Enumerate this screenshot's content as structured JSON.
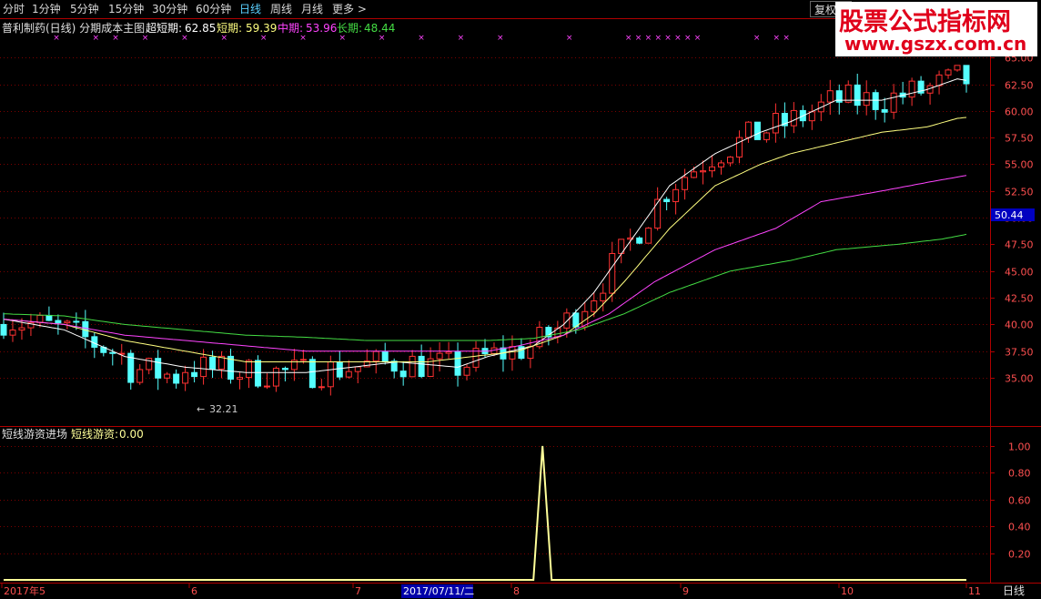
{
  "toolbar": {
    "items": [
      "分时",
      "1分钟",
      "5分钟",
      "15分钟",
      "30分钟",
      "60分钟",
      "日线",
      "周线",
      "月线",
      "更多 >"
    ],
    "active": "日线",
    "fuquan": "复权"
  },
  "watermark": {
    "line1": "股票公式指标网",
    "line2": "www.gszx.com.cn"
  },
  "main_legend": {
    "title": "普利制药(日线) 分期成本主图",
    "items": [
      {
        "label": "超短期:",
        "value": "62.85",
        "color": "#ffffff"
      },
      {
        "label": "短期:",
        "value": "59.39",
        "color": "#ffff80"
      },
      {
        "label": "中期:",
        "value": "53.96",
        "color": "#ff44ff"
      },
      {
        "label": "长期:",
        "value": "48.44",
        "color": "#44dd44"
      }
    ]
  },
  "sub_legend": {
    "title": "短线游资进场",
    "label": "短线游资:",
    "value": "0.00"
  },
  "price_axis": {
    "ticks": [
      "65.00",
      "62.50",
      "60.00",
      "57.50",
      "55.00",
      "52.50",
      "50.00",
      "47.50",
      "45.00",
      "42.50",
      "40.00",
      "37.50",
      "35.00"
    ],
    "current_price": "50.44"
  },
  "sub_axis": {
    "ticks": [
      "1.00",
      "0.80",
      "0.60",
      "0.40",
      "0.20"
    ]
  },
  "date_axis": {
    "labels": [
      "2017年5",
      "6",
      "7",
      "8",
      "9",
      "10",
      "11"
    ],
    "cursor_date": "2017/07/11/二",
    "period": "日线"
  },
  "annotations": {
    "low_label": "32.21"
  },
  "colors": {
    "up": "#ff3232",
    "down": "#54ffff",
    "axis": "#b00000",
    "grid": "#7a0000",
    "signal": "#ffff99",
    "marker": "#ff44ff"
  },
  "chart_data": [
    {
      "type": "candlestick",
      "title": "普利制药(日线)",
      "ylim": [
        31,
        68
      ],
      "series": [
        {
          "name": "超短期",
          "points": [
            [
              0,
              40.5
            ],
            [
              20,
              39.5
            ],
            [
              40,
              37
            ],
            [
              60,
              36
            ],
            [
              80,
              35.5
            ],
            [
              100,
              35.5
            ],
            [
              115,
              36
            ],
            [
              130,
              36.5
            ],
            [
              150,
              36
            ],
            [
              160,
              37
            ],
            [
              175,
              38
            ],
            [
              185,
              40
            ],
            [
              195,
              43
            ],
            [
              205,
              47
            ],
            [
              220,
              53
            ],
            [
              235,
              56
            ],
            [
              250,
              58
            ],
            [
              260,
              59
            ],
            [
              275,
              61
            ],
            [
              290,
              61
            ],
            [
              305,
              62
            ],
            [
              315,
              63
            ],
            [
              318,
              62.85
            ]
          ]
        },
        {
          "name": "短期",
          "points": [
            [
              0,
              40.5
            ],
            [
              20,
              40
            ],
            [
              40,
              38.5
            ],
            [
              60,
              37.5
            ],
            [
              80,
              36.5
            ],
            [
              100,
              36.5
            ],
            [
              120,
              36.5
            ],
            [
              140,
              36.5
            ],
            [
              155,
              37
            ],
            [
              170,
              37.5
            ],
            [
              185,
              39
            ],
            [
              195,
              41
            ],
            [
              205,
              44
            ],
            [
              220,
              49
            ],
            [
              235,
              53
            ],
            [
              250,
              55
            ],
            [
              260,
              56
            ],
            [
              275,
              57
            ],
            [
              290,
              58
            ],
            [
              305,
              58.5
            ],
            [
              315,
              59.3
            ],
            [
              318,
              59.39
            ]
          ]
        },
        {
          "name": "中期",
          "points": [
            [
              0,
              40.5
            ],
            [
              20,
              40
            ],
            [
              40,
              39
            ],
            [
              60,
              38.5
            ],
            [
              80,
              38
            ],
            [
              100,
              37.5
            ],
            [
              120,
              37.5
            ],
            [
              140,
              37.5
            ],
            [
              160,
              37.5
            ],
            [
              170,
              38
            ],
            [
              185,
              39
            ],
            [
              200,
              41
            ],
            [
              215,
              44
            ],
            [
              235,
              47
            ],
            [
              255,
              49
            ],
            [
              270,
              51.5
            ],
            [
              290,
              52.5
            ],
            [
              305,
              53.3
            ],
            [
              318,
              53.96
            ]
          ]
        },
        {
          "name": "长期",
          "points": [
            [
              0,
              41
            ],
            [
              20,
              40.8
            ],
            [
              40,
              40
            ],
            [
              60,
              39.5
            ],
            [
              80,
              39
            ],
            [
              100,
              38.8
            ],
            [
              120,
              38.5
            ],
            [
              140,
              38.5
            ],
            [
              160,
              38.5
            ],
            [
              175,
              38.7
            ],
            [
              190,
              39.5
            ],
            [
              205,
              41
            ],
            [
              220,
              43
            ],
            [
              240,
              45
            ],
            [
              260,
              46
            ],
            [
              275,
              47
            ],
            [
              295,
              47.5
            ],
            [
              310,
              48
            ],
            [
              318,
              48.44
            ]
          ]
        }
      ],
      "low_marker": {
        "value": 32.21
      }
    },
    {
      "type": "line",
      "title": "短线游资进场",
      "ylim": [
        0,
        1
      ],
      "series": [
        {
          "name": "短线游资",
          "points": [
            [
              0,
              0
            ],
            [
              172,
              0
            ],
            [
              175,
              0
            ],
            [
              178,
              1
            ],
            [
              181,
              0
            ],
            [
              318,
              0
            ]
          ]
        }
      ]
    }
  ]
}
